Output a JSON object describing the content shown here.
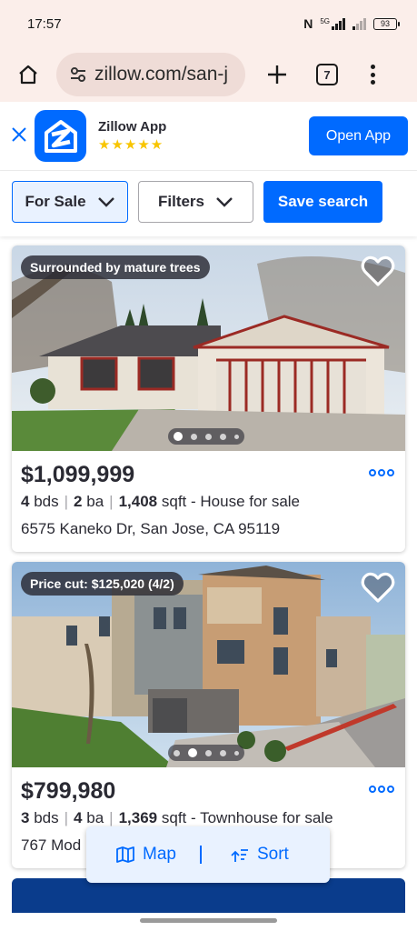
{
  "status": {
    "time": "17:57",
    "network": "5G",
    "battery": "93"
  },
  "browser": {
    "url": "zillow.com/san-j",
    "tab_count": "7"
  },
  "banner": {
    "app_name": "Zillow App",
    "stars": "★★★★★",
    "open_label": "Open App"
  },
  "filters": {
    "for_sale_label": "For Sale",
    "filters_label": "Filters",
    "save_label": "Save search"
  },
  "listings": [
    {
      "badge": "Surrounded by mature trees",
      "price": "$1,099,999",
      "beds": "4",
      "beds_unit": "bds",
      "baths": "2",
      "baths_unit": "ba",
      "sqft": "1,408",
      "sqft_unit": "sqft",
      "type": "- House for sale",
      "address": "6575 Kaneko Dr, San Jose, CA 95119"
    },
    {
      "badge": "Price cut: $125,020 (4/2)",
      "price": "$799,980",
      "beds": "3",
      "beds_unit": "bds",
      "baths": "4",
      "baths_unit": "ba",
      "sqft": "1,369",
      "sqft_unit": "sqft",
      "type": "- Townhouse for sale",
      "address": "767 Mod"
    }
  ],
  "map_sort": {
    "map_label": "Map",
    "sort_label": "Sort"
  },
  "colors": {
    "brand": "#006aff",
    "text": "#2a2a33",
    "browser_bg": "#fbeeea"
  }
}
